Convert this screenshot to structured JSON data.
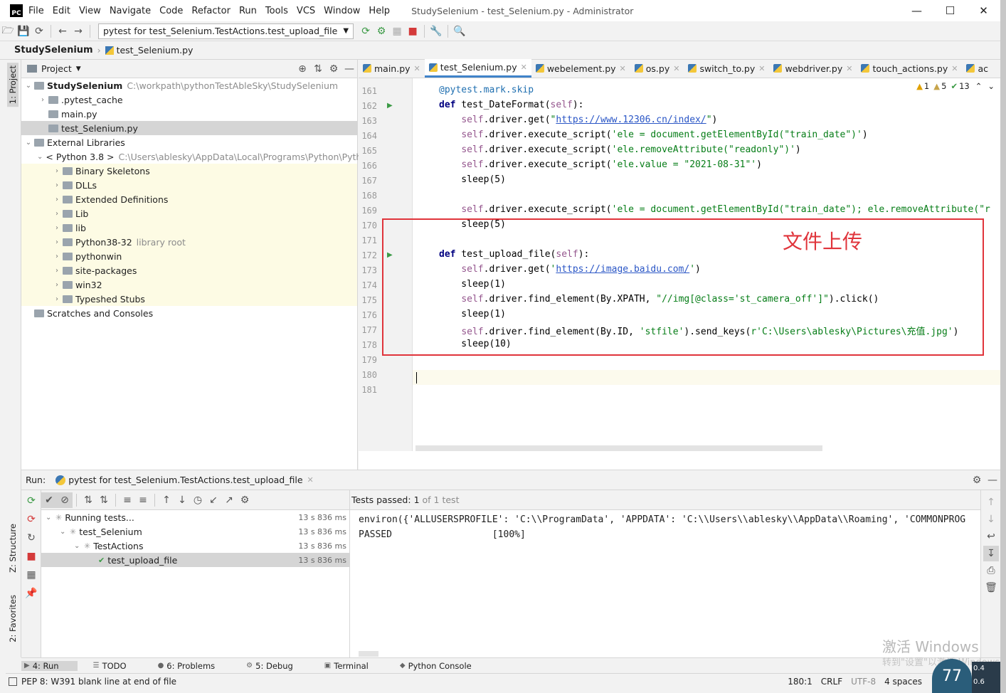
{
  "app": {
    "logo_text": "PC",
    "window_title": "StudySelenium - test_Selenium.py - Administrator",
    "menu": [
      "File",
      "Edit",
      "View",
      "Navigate",
      "Code",
      "Refactor",
      "Run",
      "Tools",
      "VCS",
      "Window",
      "Help"
    ]
  },
  "toolbar": {
    "run_config": "pytest for test_Selenium.TestActions.test_upload_file"
  },
  "breadcrumb": {
    "project": "StudySelenium",
    "file": "test_Selenium.py"
  },
  "side_tabs": {
    "project": "1: Project",
    "structure": "Z: Structure",
    "favorites": "2: Favorites"
  },
  "project_panel": {
    "title": "Project",
    "root_name": "StudySelenium",
    "root_path": "C:\\workpath\\pythonTestAbleSky\\StudySelenium",
    "items": [
      {
        "name": ".pytest_cache",
        "indent": 1,
        "arrow": true
      },
      {
        "name": "main.py",
        "indent": 1,
        "arrow": false
      },
      {
        "name": "test_Selenium.py",
        "indent": 1,
        "arrow": false,
        "selected": true
      },
      {
        "name": "External Libraries",
        "indent": 0,
        "arrow": true,
        "open": true
      },
      {
        "name": "< Python 3.8 >",
        "extra": "C:\\Users\\ablesky\\AppData\\Local\\Programs\\Python\\Pyth",
        "indent": 1,
        "arrow": true,
        "open": true
      },
      {
        "name": "Binary Skeletons",
        "indent": 2,
        "arrow": true,
        "lib": true
      },
      {
        "name": "DLLs",
        "indent": 2,
        "arrow": true,
        "lib": true
      },
      {
        "name": "Extended Definitions",
        "indent": 2,
        "arrow": true,
        "lib": true
      },
      {
        "name": "Lib",
        "indent": 2,
        "arrow": true,
        "lib": true
      },
      {
        "name": "lib",
        "indent": 2,
        "arrow": true,
        "lib": true
      },
      {
        "name": "Python38-32",
        "extra": "library root",
        "indent": 2,
        "arrow": true,
        "lib": true
      },
      {
        "name": "pythonwin",
        "indent": 2,
        "arrow": true,
        "lib": true
      },
      {
        "name": "site-packages",
        "indent": 2,
        "arrow": true,
        "lib": true
      },
      {
        "name": "win32",
        "indent": 2,
        "arrow": true,
        "lib": true
      },
      {
        "name": "Typeshed Stubs",
        "indent": 2,
        "arrow": true,
        "lib": true
      },
      {
        "name": "Scratches and Consoles",
        "indent": 0,
        "arrow": false
      }
    ]
  },
  "editor_tabs": [
    {
      "label": "main.py"
    },
    {
      "label": "test_Selenium.py",
      "active": true
    },
    {
      "label": "webelement.py"
    },
    {
      "label": "os.py"
    },
    {
      "label": "switch_to.py"
    },
    {
      "label": "webdriver.py"
    },
    {
      "label": "touch_actions.py"
    },
    {
      "label": "ac"
    }
  ],
  "inspections": {
    "errors": "1",
    "warnings": "5",
    "ok": "13"
  },
  "code_lines": [
    {
      "n": "161",
      "html": "<span class=\"dec\">@pytest.mark.skip</span>"
    },
    {
      "n": "162",
      "html": "<span class=\"kw\">def</span> test_DateFormat(<span class=\"sf\">self</span>):"
    },
    {
      "n": "163",
      "html": "    <span class=\"sf\">self</span>.driver.get(<span class=\"st\">\"</span><span class=\"lk\">https://www.12306.cn/index/</span><span class=\"st\">\"</span>)"
    },
    {
      "n": "164",
      "html": "    <span class=\"sf\">self</span>.driver.execute_script(<span class=\"st\">'ele = document.getElementById(\"train_date\")'</span>)"
    },
    {
      "n": "165",
      "html": "    <span class=\"sf\">self</span>.driver.execute_script(<span class=\"st\">'ele.removeAttribute(\"readonly\")'</span>)"
    },
    {
      "n": "166",
      "html": "    <span class=\"sf\">self</span>.driver.execute_script(<span class=\"st\">'ele.value = \"2021-08-31\"'</span>)"
    },
    {
      "n": "167",
      "html": "    sleep(5)"
    },
    {
      "n": "168",
      "html": ""
    },
    {
      "n": "169",
      "html": "    <span class=\"sf\">self</span>.driver.execute_script(<span class=\"st\">'ele = document.getElementById(\"train_date\"); ele.removeAttribute(\"r</span>"
    },
    {
      "n": "170",
      "html": "    sleep(5)"
    },
    {
      "n": "171",
      "html": ""
    },
    {
      "n": "172",
      "html": "<span class=\"kw\">def</span> test_upload_file(<span class=\"sf\">self</span>):"
    },
    {
      "n": "173",
      "html": "    <span class=\"sf\">self</span>.driver.get(<span class=\"st\">'</span><span class=\"lk\">https://image.baidu.com/</span><span class=\"st\">'</span>)"
    },
    {
      "n": "174",
      "html": "    sleep(1)"
    },
    {
      "n": "175",
      "html": "    <span class=\"sf\">self</span>.driver.find_element(By.XPATH, <span class=\"st\">\"//img[@class='st_camera_off']\"</span>).click()"
    },
    {
      "n": "176",
      "html": "    sleep(1)"
    },
    {
      "n": "177",
      "html": "    <span class=\"sf\">self</span>.driver.find_element(By.ID, <span class=\"st\">'stfile'</span>).send_keys(<span class=\"st\">r'C:\\Users\\ablesky\\Pictures\\充值.jpg'</span>)"
    },
    {
      "n": "178",
      "html": "    sleep(10)"
    },
    {
      "n": "179",
      "html": ""
    },
    {
      "n": "180",
      "html": ""
    },
    {
      "n": "181",
      "html": ""
    }
  ],
  "annotation": "文件上传",
  "run_panel": {
    "label": "Run:",
    "config": "pytest for test_Selenium.TestActions.test_upload_file",
    "tests_passed_label": "Tests passed:",
    "tests_passed_count": "1",
    "tests_passed_of": "of 1 test",
    "tree": [
      {
        "name": "Running tests...",
        "time": "13 s 836 ms",
        "indent": 0
      },
      {
        "name": "test_Selenium",
        "time": "13 s 836 ms",
        "indent": 1
      },
      {
        "name": "TestActions",
        "time": "13 s 836 ms",
        "indent": 2
      },
      {
        "name": "test_upload_file",
        "time": "13 s 836 ms",
        "indent": 3,
        "selected": true
      }
    ],
    "console": [
      "environ({'ALLUSERSPROFILE': 'C:\\\\ProgramData', 'APPDATA': 'C:\\\\Users\\\\ablesky\\\\AppData\\\\Roaming', 'COMMONPROG",
      "PASSED                  [100%]"
    ]
  },
  "bottom_tabs": [
    "4: Run",
    "TODO",
    "6: Problems",
    "5: Debug",
    "Terminal",
    "Python Console"
  ],
  "status": {
    "message": "PEP 8: W391 blank line at end of file",
    "position": "180:1",
    "line_sep": "CRLF",
    "encoding": "UTF-8",
    "indent": "4 spaces"
  },
  "watermark": {
    "line1": "激活 Windows",
    "line2": "转到\"设置\"以激活 Windows"
  },
  "gauge_value": "77",
  "net": {
    "up": "0.4",
    "down": "0.6"
  }
}
